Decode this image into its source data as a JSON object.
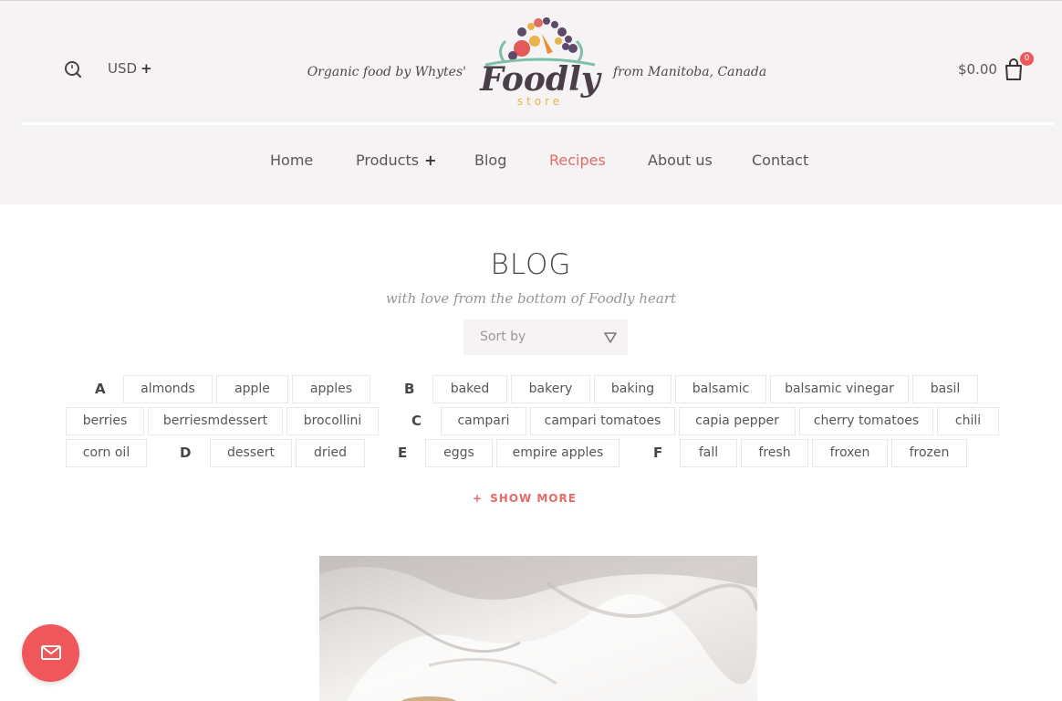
{
  "header": {
    "currency_label": "USD",
    "currency_plus": "+",
    "tagline_left": "Organic food by Whytes'",
    "tagline_right": "from Manitoba, Canada",
    "logo_text": "Foodly",
    "logo_subtext": "store",
    "cart_total": "$0.00",
    "cart_count": "0",
    "icons": {
      "search": "search-icon",
      "cart": "shopping-bag-icon"
    }
  },
  "nav": {
    "items": [
      {
        "label": "Home"
      },
      {
        "label": "Products",
        "suffix": "+"
      },
      {
        "label": "Blog"
      },
      {
        "label": "Recipes",
        "active": true
      },
      {
        "label": "About us"
      },
      {
        "label": "Contact"
      }
    ]
  },
  "blog": {
    "title": "BLOG",
    "subtitle": "with love from the bottom of Foodly heart",
    "sort_placeholder": "Sort by"
  },
  "tags": {
    "letters": [
      "A",
      "B",
      "C",
      "D",
      "E",
      "F"
    ],
    "items": [
      "almonds",
      "apple",
      "apples",
      "baked",
      "bakery",
      "baking",
      "balsamic",
      "balsamic vinegar",
      "basil",
      "berries",
      "berriesmdessert",
      "brocollini",
      "campari",
      "campari tomatoes",
      "capia pepper",
      "cherry tomatoes",
      "chili",
      "corn oil",
      "dessert",
      "dried",
      "eggs",
      "empire apples",
      "fall",
      "fresh",
      "froxen",
      "frozen"
    ],
    "show_more": "SHOW MORE",
    "show_more_icon": "+"
  },
  "colors": {
    "accent": "#e36b68",
    "header_bg": "#f5f3f3",
    "fab": "#f0575b"
  },
  "fab": {
    "icon": "mail-icon"
  }
}
